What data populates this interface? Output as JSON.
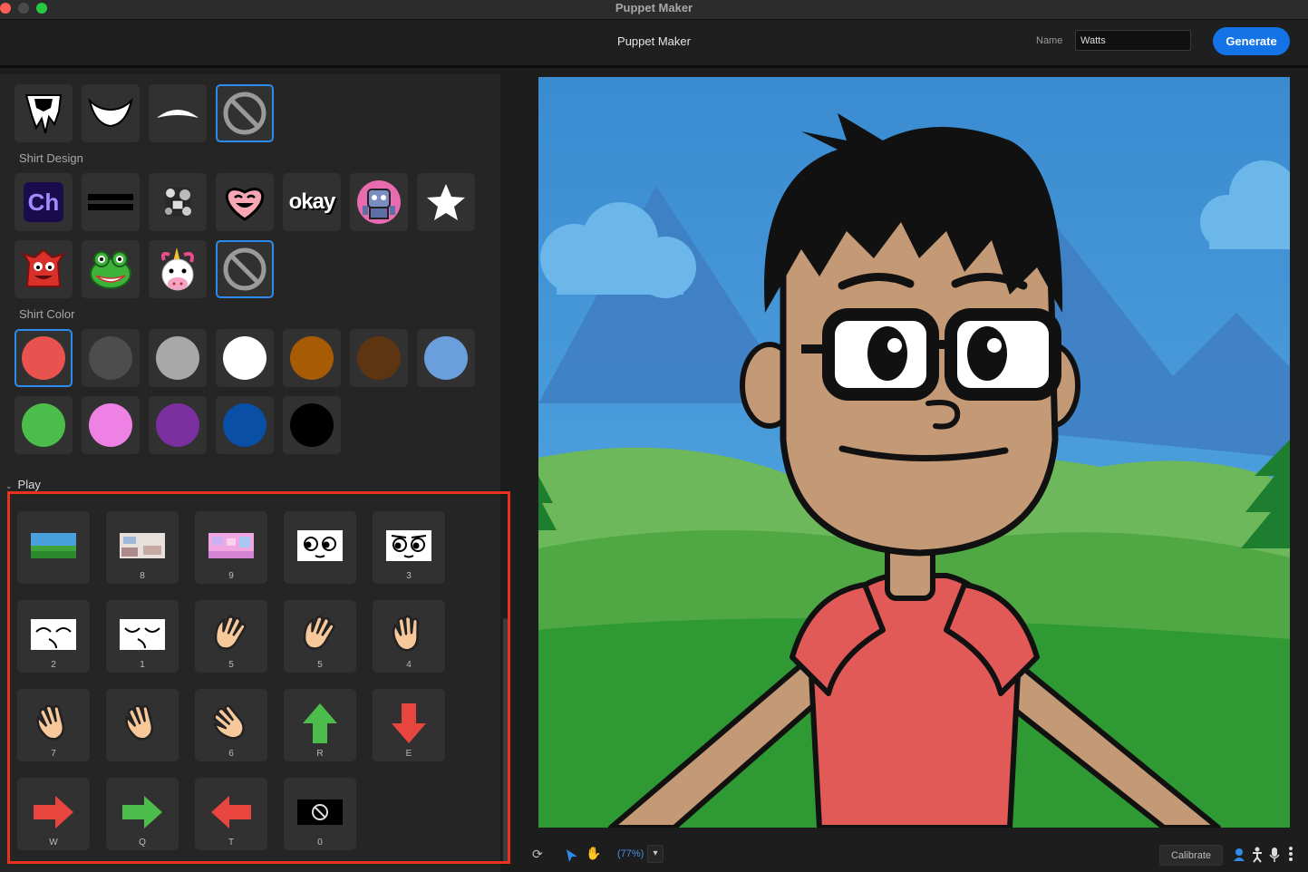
{
  "window": {
    "title": "Puppet Maker"
  },
  "header": {
    "title": "Puppet Maker",
    "name_label": "Name",
    "name_value": "Watts",
    "generate_label": "Generate"
  },
  "left_panel": {
    "beard_row": [
      "spiky-beard-icon",
      "full-beard-icon",
      "mustache-icon",
      "none-icon"
    ],
    "shirt_design_label": "Shirt Design",
    "shirt_designs": [
      {
        "icon": "ch-logo-icon",
        "text": "Ch"
      },
      {
        "icon": "stripes-icon"
      },
      {
        "icon": "doodle-icon"
      },
      {
        "icon": "heart-face-icon"
      },
      {
        "icon": "okay-text-icon",
        "text": "okay"
      },
      {
        "icon": "robot-icon"
      },
      {
        "icon": "star-icon"
      },
      {
        "icon": "red-monster-icon"
      },
      {
        "icon": "frog-icon"
      },
      {
        "icon": "unicorn-icon"
      },
      {
        "icon": "none-icon"
      }
    ],
    "shirt_color_label": "Shirt Color",
    "shirt_colors": [
      "#e8534f",
      "#4d4d4d",
      "#a8a8a8",
      "#ffffff",
      "#a75b04",
      "#5e3511",
      "#6a9edc",
      "#4cbc4a",
      "#ee82e4",
      "#7b2fa1",
      "#0a4fa6",
      "#000000"
    ],
    "play_label": "Play",
    "triggers": [
      {
        "key": "",
        "icon": "landscape-background-icon"
      },
      {
        "key": "8",
        "icon": "room-background-icon"
      },
      {
        "key": "9",
        "icon": "pink-background-icon"
      },
      {
        "key": "",
        "icon": "eyes-left-icon"
      },
      {
        "key": "3",
        "icon": "eyes-wink-icon"
      },
      {
        "key": "2",
        "icon": "eyes-happy-icon"
      },
      {
        "key": "1",
        "icon": "eyes-closed-icon"
      },
      {
        "key": "5",
        "icon": "hand-wave-icon"
      },
      {
        "key": "5",
        "icon": "hand-wave-icon"
      },
      {
        "key": "4",
        "icon": "hand-point-icon"
      },
      {
        "key": "7",
        "icon": "hand-open-icon"
      },
      {
        "key": "",
        "icon": "hand-open-icon"
      },
      {
        "key": "6",
        "icon": "hand-flat-icon"
      },
      {
        "key": "R",
        "icon": "arrow-up-icon"
      },
      {
        "key": "E",
        "icon": "arrow-down-icon"
      },
      {
        "key": "W",
        "icon": "arrow-right-icon"
      },
      {
        "key": "Q",
        "icon": "arrow-right-icon"
      },
      {
        "key": "T",
        "icon": "arrow-left-icon"
      },
      {
        "key": "0",
        "icon": "none-icon"
      }
    ]
  },
  "bottom_bar": {
    "zoom": "(77%)",
    "calibrate_label": "Calibrate"
  },
  "icons": {
    "refresh": "refresh-icon",
    "select": "select-arrow-icon",
    "hand": "hand-tool-icon",
    "camera": "camera-icon",
    "body": "body-tracking-icon",
    "mic": "microphone-icon",
    "more": "more-icon"
  },
  "colors": {
    "accent": "#1473e6",
    "highlight": "#e8321e",
    "selection": "#2d8ceb"
  }
}
